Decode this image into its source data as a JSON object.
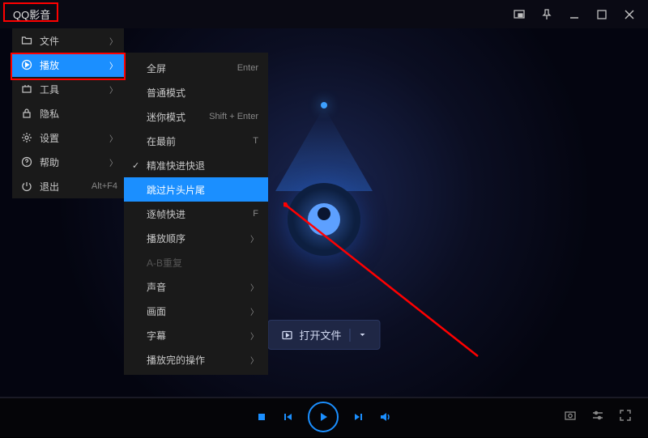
{
  "app_title": "QQ影音",
  "main_menu": [
    {
      "icon": "folder",
      "label": "文件",
      "chevron": true
    },
    {
      "icon": "play",
      "label": "播放",
      "chevron": true,
      "selected": true
    },
    {
      "icon": "tools",
      "label": "工具",
      "chevron": true
    },
    {
      "icon": "lock",
      "label": "隐私"
    },
    {
      "icon": "gear",
      "label": "设置",
      "chevron": true
    },
    {
      "icon": "help",
      "label": "帮助",
      "chevron": true
    },
    {
      "icon": "power",
      "label": "退出",
      "shortcut": "Alt+F4"
    }
  ],
  "sub_menu": [
    {
      "label": "全屏",
      "shortcut": "Enter"
    },
    {
      "label": "普通模式"
    },
    {
      "label": "迷你模式",
      "shortcut": "Shift + Enter"
    },
    {
      "label": "在最前",
      "shortcut": "T"
    },
    {
      "label": "精准快进快退",
      "checked": true
    },
    {
      "label": "跳过片头片尾",
      "selected": true
    },
    {
      "label": "逐帧快进",
      "shortcut": "F"
    },
    {
      "label": "播放顺序",
      "chevron": true
    },
    {
      "label": "A-B重复",
      "disabled": true
    },
    {
      "label": "声音",
      "chevron": true
    },
    {
      "label": "画面",
      "chevron": true
    },
    {
      "label": "字幕",
      "chevron": true
    },
    {
      "label": "播放完的操作",
      "chevron": true
    }
  ],
  "open_file_button": "打开文件"
}
